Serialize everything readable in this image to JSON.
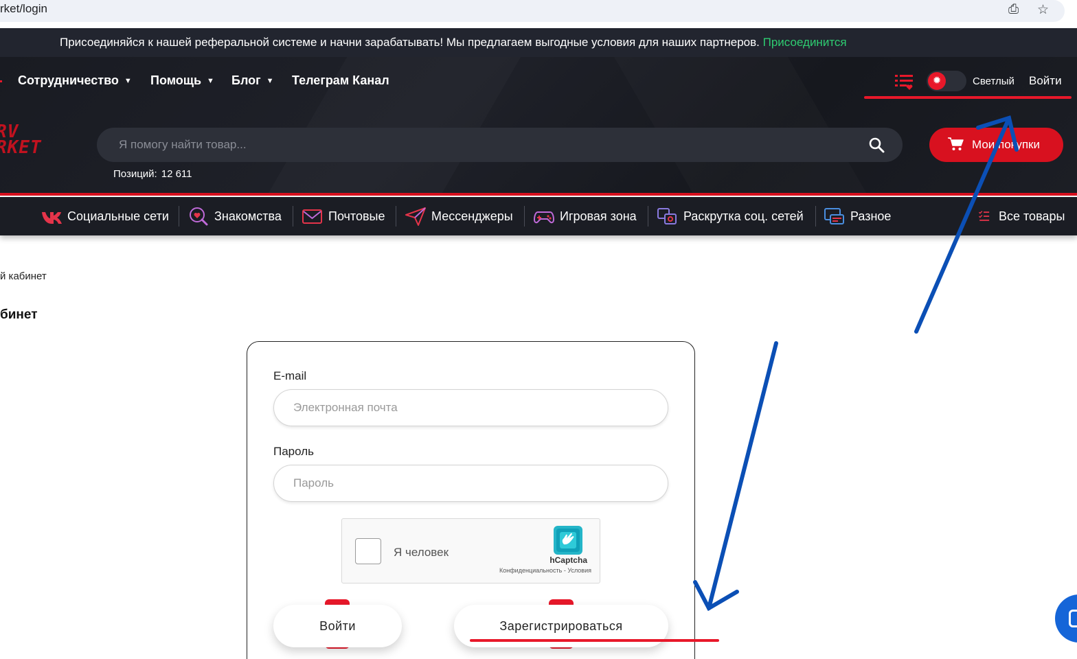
{
  "browser": {
    "url_fragment": "rket/login",
    "install_icon": "install-app-icon",
    "star_icon": "bookmark-star-icon"
  },
  "banner": {
    "text": "Присоединяйся к нашей реферальной системе и начни зарабатывать! Мы предлагаем выгодные условия для наших партнеров.",
    "link": "Присоединится"
  },
  "topnav": {
    "items": [
      {
        "label": "Сотрудничество",
        "has_dropdown": true
      },
      {
        "label": "Помощь",
        "has_dropdown": true
      },
      {
        "label": "Блог",
        "has_dropdown": true
      },
      {
        "label": "Телеграм Канал",
        "has_dropdown": false
      }
    ],
    "theme_label": "Светлый",
    "login_label": "Войти"
  },
  "logo": {
    "line1": "RV",
    "line2": "RKET"
  },
  "search": {
    "placeholder": "Я помогу найти товар...",
    "positions_label": "Позиций:",
    "positions_value": "12 611"
  },
  "cart": {
    "label": "Мои покупки"
  },
  "categories": [
    {
      "label": "Социальные сети",
      "icon": "vk-icon"
    },
    {
      "label": "Знакомства",
      "icon": "dating-icon"
    },
    {
      "label": "Почтовые",
      "icon": "mail-icon"
    },
    {
      "label": "Мессенджеры",
      "icon": "paper-plane-icon"
    },
    {
      "label": "Игровая зона",
      "icon": "gamepad-icon"
    },
    {
      "label": "Раскрутка соц. сетей",
      "icon": "promo-icon"
    },
    {
      "label": "Разное",
      "icon": "misc-icon"
    }
  ],
  "all_products": "Все товары",
  "page": {
    "breadcrumb": "й кабинет",
    "title": "бинет"
  },
  "form": {
    "email_label": "E-mail",
    "email_placeholder": "Электронная почта",
    "password_label": "Пароль",
    "password_placeholder": "Пароль",
    "captcha_label": "Я человек",
    "captcha_brand": "hCaptcha",
    "captcha_links": "Конфиденциальность - Условия",
    "login_button": "Войти",
    "register_button": "Зарегистрироваться"
  },
  "colors": {
    "accent_red": "#d8111f",
    "header_bg": "#1b1d24",
    "banner_link": "#2ecc71",
    "annotation_blue": "#0b4fb5"
  }
}
